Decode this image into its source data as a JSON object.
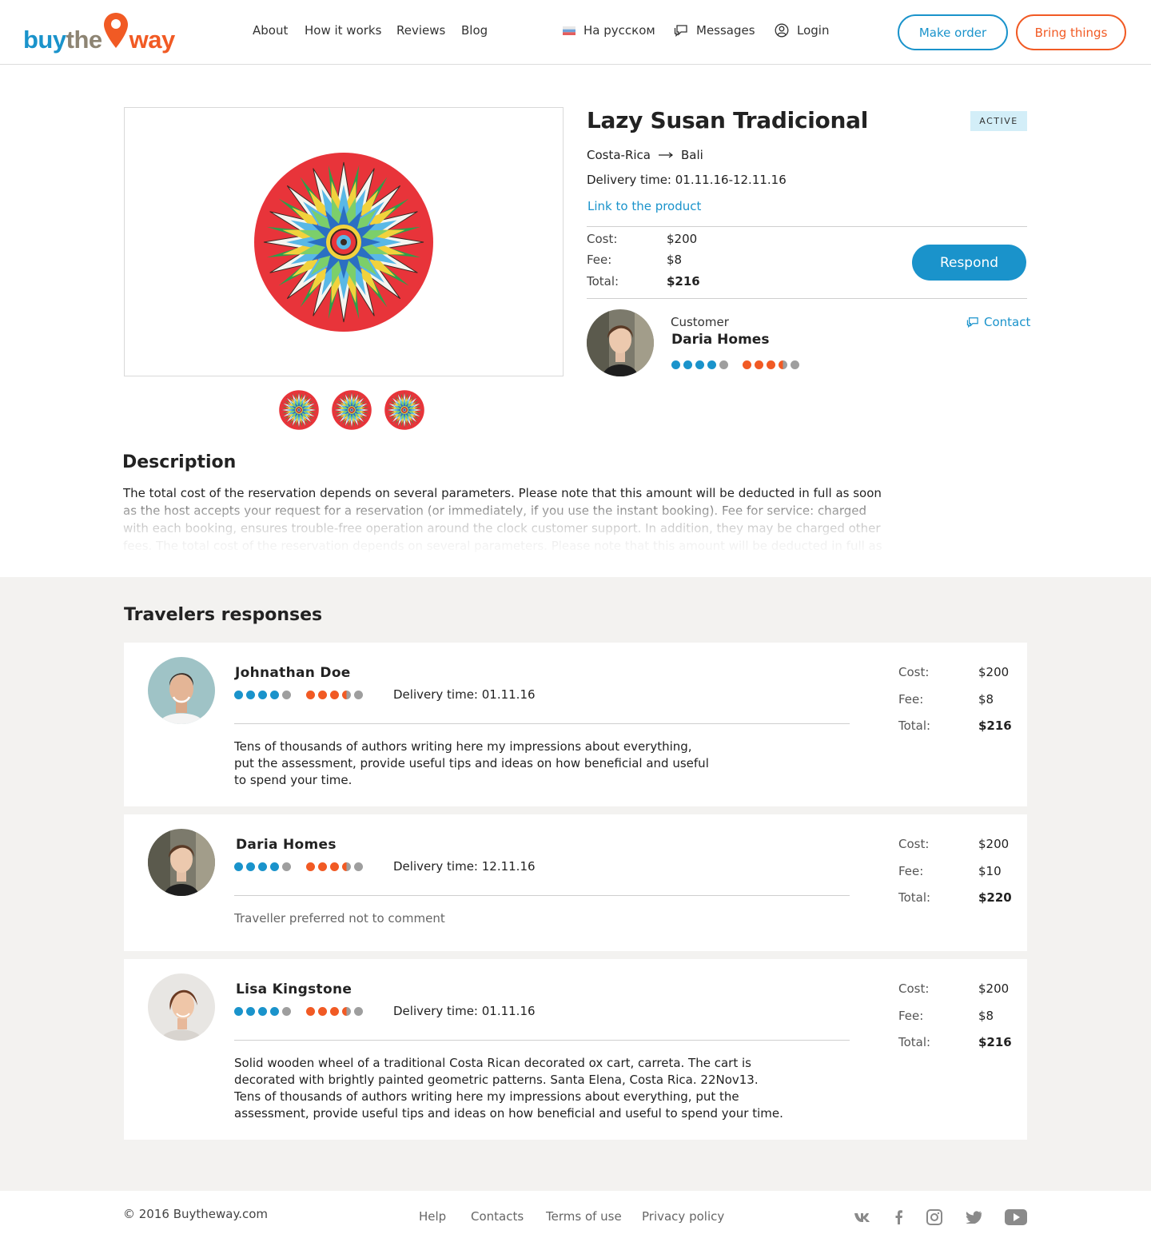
{
  "header": {
    "logo": {
      "part1": "buy",
      "part2": "the",
      "part3": "way"
    },
    "nav": [
      "About",
      "How it works",
      "Reviews",
      "Blog"
    ],
    "language": "На русском",
    "messages": "Messages",
    "login": "Login",
    "make_order": "Make order",
    "bring_things": "Bring things"
  },
  "product": {
    "title": "Lazy Susan Tradicional",
    "status": "ACTIVE",
    "from": "Costa-Rica",
    "to": "Bali",
    "delivery_label": "Delivery time:",
    "delivery_value": "01.11.16-12.11.16",
    "link_text": "Link to the product",
    "cost_label": "Cost:",
    "cost": "$200",
    "fee_label": "Fee:",
    "fee": "$8",
    "total_label": "Total:",
    "total": "$216",
    "respond": "Respond"
  },
  "customer": {
    "label": "Customer",
    "name": "Daria Homes",
    "contact": "Contact",
    "rating_blue": 4,
    "rating_orange": 3.5
  },
  "description": {
    "title": "Description",
    "text": "The total cost of the reservation depends on several parameters. Please note that this amount will be deducted in full as soon as the host accepts your request for a reservation (or immediately, if you use the instant booking). Fee for service: charged with each booking, ensures trouble-free operation around the clock customer support. In addition, they may be charged other fees. The total cost of the reservation depends on several parameters. Please note that this amount will be deducted in full as soon as the host accepts your request for a reservation."
  },
  "responses": {
    "title": "Travelers responses",
    "items": [
      {
        "name": "Johnathan Doe",
        "delivery": "Delivery time: 01.11.16",
        "comment": "Tens of thousands of authors writing here my impressions about everything, put the assessment, provide useful tips and ideas on how beneficial and useful to spend your time.",
        "cost_label": "Cost:",
        "cost": "$200",
        "fee_label": "Fee:",
        "fee": "$8",
        "total_label": "Total:",
        "total": "$216"
      },
      {
        "name": "Daria Homes",
        "delivery": "Delivery time: 12.11.16",
        "comment": "Traveller preferred not to comment",
        "cost_label": "Cost:",
        "cost": "$200",
        "fee_label": "Fee:",
        "fee": "$10",
        "total_label": "Total:",
        "total": "$220"
      },
      {
        "name": "Lisa Kingstone",
        "delivery": "Delivery time: 01.11.16",
        "comment": "Solid wooden wheel of a traditional Costa Rican decorated ox cart, carreta. The cart is decorated with brightly painted geometric patterns. Santa Elena, Costa Rica. 22Nov13. Tens of thousands of authors writing here my impressions about everything, put the assessment, provide useful tips and ideas on how beneficial and useful to spend your time.",
        "cost_label": "Cost:",
        "cost": "$200",
        "fee_label": "Fee:",
        "fee": "$8",
        "total_label": "Total:",
        "total": "$216"
      }
    ]
  },
  "footer": {
    "copyright": "© 2016 Buytheway.com",
    "links": [
      "Help",
      "Contacts",
      "Terms of use",
      "Privacy policy"
    ],
    "social_icons": [
      "vk-icon",
      "facebook-icon",
      "instagram-icon",
      "twitter-icon",
      "youtube-icon"
    ]
  },
  "colors": {
    "brand_blue": "#1a93cb",
    "brand_orange": "#f15a24",
    "rating_gray": "#9e9e9e",
    "badge_bg": "#d3eef8"
  }
}
